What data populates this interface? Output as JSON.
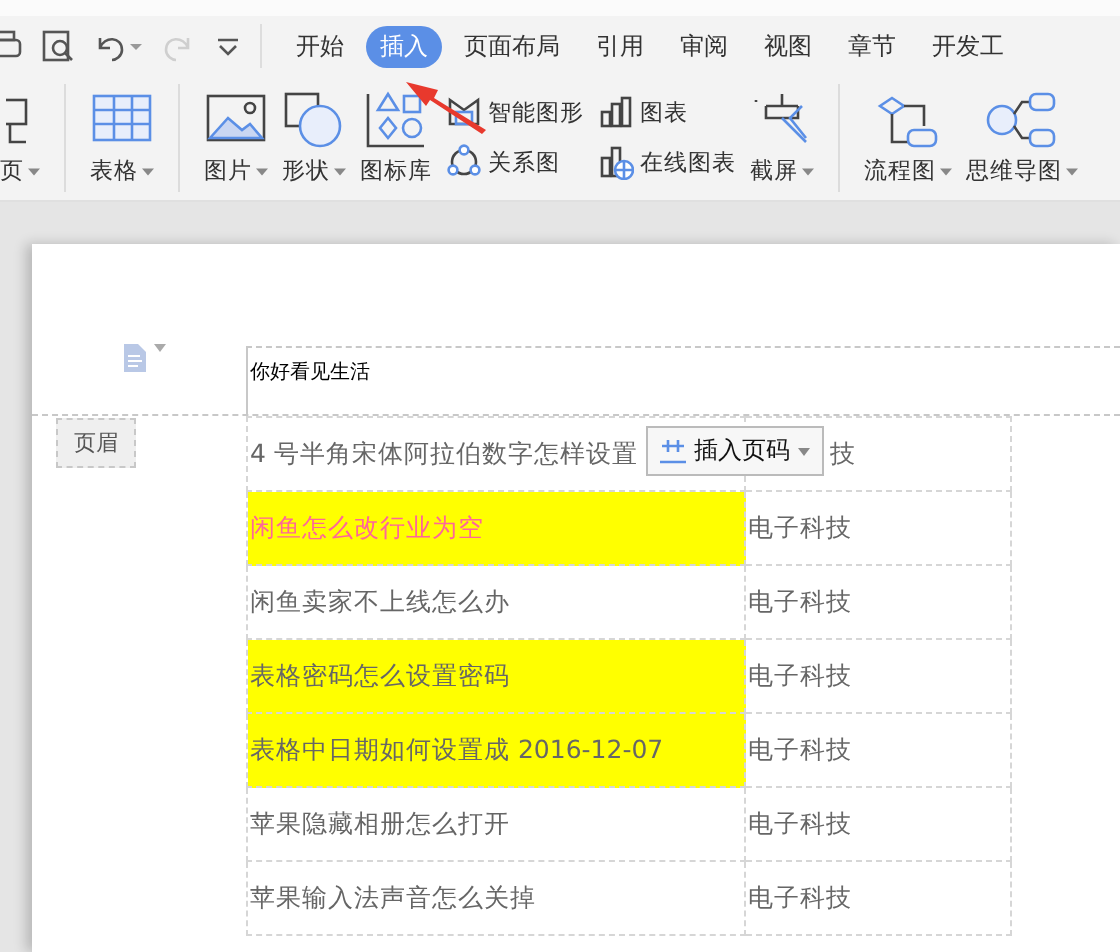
{
  "tabs": [
    {
      "label": "开始",
      "selected": false
    },
    {
      "label": "插入",
      "selected": true
    },
    {
      "label": "页面布局",
      "selected": false
    },
    {
      "label": "引用",
      "selected": false
    },
    {
      "label": "审阅",
      "selected": false
    },
    {
      "label": "视图",
      "selected": false
    },
    {
      "label": "章节",
      "selected": false
    },
    {
      "label": "开发工",
      "selected": false
    }
  ],
  "quick_access": [
    {
      "kind": "print",
      "disabled": false
    },
    {
      "kind": "preview",
      "disabled": false
    },
    {
      "kind": "undo",
      "disabled": false
    },
    {
      "kind": "redo",
      "disabled": true
    },
    {
      "kind": "customize",
      "disabled": false
    }
  ],
  "ribbon": [
    {
      "kind": "large",
      "label": "页",
      "dropdown": true
    },
    {
      "kind": "separator"
    },
    {
      "kind": "large",
      "label": "表格",
      "dropdown": true
    },
    {
      "kind": "separator"
    },
    {
      "kind": "large",
      "label": "图片",
      "dropdown": true
    },
    {
      "kind": "large",
      "label": "形状",
      "dropdown": true
    },
    {
      "kind": "large",
      "label": "图标库",
      "dropdown": false
    },
    {
      "kind": "pair",
      "items": [
        "智能图形",
        "关系图"
      ]
    },
    {
      "kind": "pair",
      "items": [
        "图表",
        "在线图表"
      ]
    },
    {
      "kind": "large",
      "label": "截屏",
      "dropdown": true
    },
    {
      "kind": "separator"
    },
    {
      "kind": "large",
      "label": "流程图",
      "dropdown": true
    },
    {
      "kind": "large",
      "label": "思维导图",
      "dropdown": true
    }
  ],
  "header": {
    "text": "你好看见生活",
    "tag": "页眉",
    "insert_page_number_button": "插入页码"
  },
  "table": {
    "rows": [
      {
        "cells": [
          "4 号半角宋体阿拉伯数字怎样设置",
          "技"
        ],
        "highlighted": false,
        "color": "#666666"
      },
      {
        "cells": [
          "闲鱼怎么改行业为空",
          "电子科技"
        ],
        "highlighted": true,
        "color": "#ff6699"
      },
      {
        "cells": [
          "闲鱼卖家不上线怎么办",
          "电子科技"
        ],
        "highlighted": false,
        "color": "#666666"
      },
      {
        "cells": [
          "表格密码怎么设置密码",
          "电子科技"
        ],
        "highlighted": true,
        "color": "#666666"
      },
      {
        "cells": [
          "表格中日期如何设置成 2016-12-07",
          "电子科技"
        ],
        "highlighted": true,
        "color": "#666666"
      },
      {
        "cells": [
          "苹果隐藏相册怎么打开",
          "电子科技"
        ],
        "highlighted": false,
        "color": "#666666"
      },
      {
        "cells": [
          "苹果输入法声音怎么关掉",
          "电子科技"
        ],
        "highlighted": false,
        "color": "#666666"
      }
    ]
  }
}
